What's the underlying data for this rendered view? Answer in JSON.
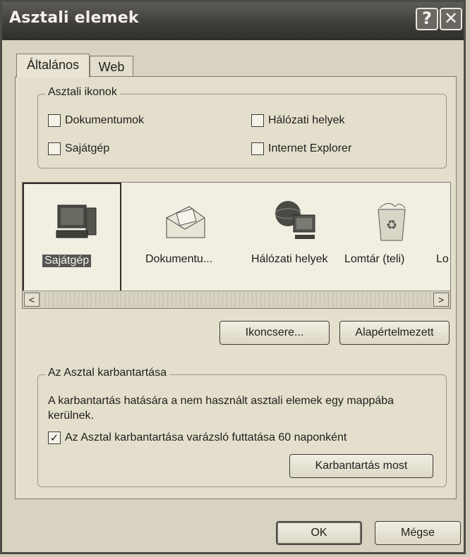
{
  "window": {
    "title": "Asztali elemek"
  },
  "titlebar": {
    "help_glyph": "?",
    "close_glyph": "✕"
  },
  "tabs": [
    {
      "label": "Általános",
      "active": true
    },
    {
      "label": "Web",
      "active": false
    }
  ],
  "desktop_icons": {
    "legend": "Asztali ikonok",
    "checkboxes": [
      {
        "label": "Dokumentumok",
        "checked": false
      },
      {
        "label": "Hálózati helyek",
        "checked": false
      },
      {
        "label": "Sajátgép",
        "checked": false
      },
      {
        "label": "Internet Explorer",
        "checked": false
      }
    ]
  },
  "icon_list": {
    "items": [
      {
        "label": "Sajátgép",
        "icon": "computer-icon",
        "selected": true
      },
      {
        "label": "Dokumentu...",
        "icon": "documents-folder-icon",
        "selected": false
      },
      {
        "label": "Hálózati helyek",
        "icon": "network-places-icon",
        "selected": false
      },
      {
        "label": "Lomtár (teli)",
        "icon": "recycle-bin-full-icon",
        "selected": false
      },
      {
        "label": "Lo",
        "icon": "recycle-bin-empty-icon",
        "selected": false
      }
    ],
    "scroll_left_glyph": "<",
    "scroll_right_glyph": ">"
  },
  "icon_buttons": {
    "change_icon": "Ikoncsere...",
    "default": "Alapértelmezett"
  },
  "cleanup": {
    "legend": "Az Asztal karbantartása",
    "description": "A karbantartás hatására a nem használt asztali elemek egy mappába kerülnek.",
    "checkbox_label": "Az Asztal karbantartása varázsló futtatása 60 naponként",
    "checkbox_checked": true,
    "check_glyph": "✓",
    "run_now_button": "Karbantartás most"
  },
  "footer": {
    "ok": "OK",
    "cancel": "Mégse"
  }
}
